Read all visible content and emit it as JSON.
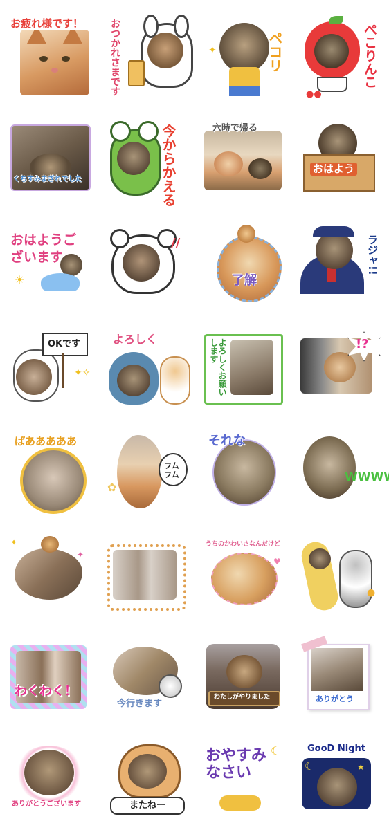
{
  "stickers": [
    {
      "caption": "お疲れ様です！",
      "color": "#e8403a"
    },
    {
      "caption": "おつかれさまです",
      "color": "#e0456a"
    },
    {
      "caption": "ペコリ",
      "color": "#f0a020"
    },
    {
      "caption": "ぺこりんこ",
      "color": "#e83040"
    },
    {
      "caption": "くちすみまぎれでした",
      "color": "#4a8cd0"
    },
    {
      "caption": "今からかえる",
      "color": "#e84030"
    },
    {
      "caption": "六時で帰る",
      "color": "#555555"
    },
    {
      "caption": "おはよう",
      "color": "#ffffff"
    },
    {
      "caption": "おはようございます",
      "color": "#e04080"
    },
    {
      "caption": "",
      "color": "#333333"
    },
    {
      "caption": "了解",
      "color": "#7a5ac0"
    },
    {
      "caption": "ラジャ!!",
      "color": "#1a3a8a"
    },
    {
      "caption": "OKです",
      "color": "#222222"
    },
    {
      "caption": "よろしく",
      "color": "#e05080"
    },
    {
      "caption": "よろしくお願いします",
      "color": "#3a9a3a"
    },
    {
      "caption": "!?",
      "color": "#e83090"
    },
    {
      "caption": "ぱあああああ",
      "color": "#e8a020"
    },
    {
      "caption": "フムフム",
      "color": "#222222"
    },
    {
      "caption": "それな",
      "color": "#5a6ad0"
    },
    {
      "caption": "WWWW",
      "color": "#4ac040"
    },
    {
      "caption": "",
      "color": "#333333"
    },
    {
      "caption": "",
      "color": "#333333"
    },
    {
      "caption": "うちのかわいさなんだけど",
      "color": "#e06090"
    },
    {
      "caption": "",
      "color": "#333333"
    },
    {
      "caption": "わくわく！",
      "color": "#e83090"
    },
    {
      "caption": "今行きます",
      "color": "#6a8ac0"
    },
    {
      "caption": "わたしがやりました",
      "color": "#ffffff"
    },
    {
      "caption": "ありがとう",
      "color": "#3a6ad0"
    },
    {
      "caption": "ありがとうございます",
      "color": "#e04080"
    },
    {
      "caption": "またねー",
      "color": "#222222"
    },
    {
      "caption": "おやすみなさい",
      "color": "#6a3ab0"
    },
    {
      "caption": "GooD Night",
      "color": "#1a2a8a"
    }
  ],
  "icons": {
    "sparkle": "sparkle-icon",
    "heart": "heart-icon",
    "paw": "paw-icon",
    "star": "star-icon",
    "moon": "moon-icon"
  }
}
